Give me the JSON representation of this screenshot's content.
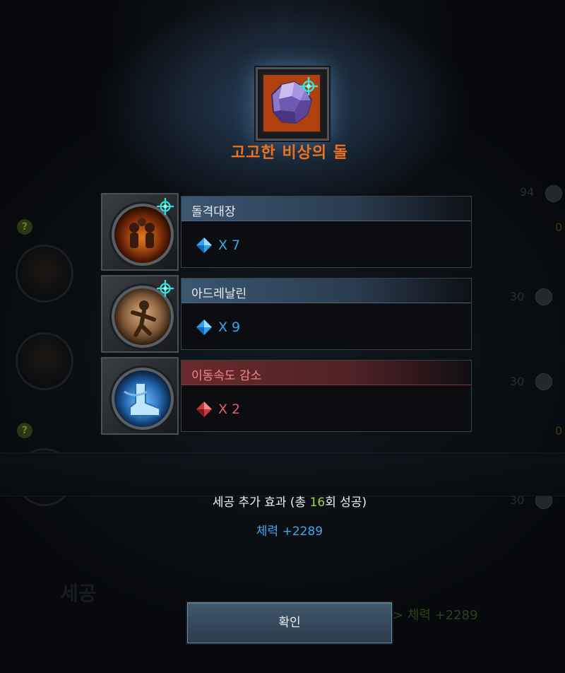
{
  "item": {
    "name": "고고한 비상의 돌",
    "icon": "crystal-stone-icon",
    "frame_color": "#b0410f"
  },
  "skills": [
    {
      "name": "돌격대장",
      "count_prefix": "X",
      "count": "7",
      "type": "positive",
      "gem": "blue-gem-icon",
      "icon": "charge-captain-icon"
    },
    {
      "name": "아드레날린",
      "count_prefix": "X",
      "count": "9",
      "type": "positive",
      "gem": "blue-gem-icon",
      "icon": "adrenaline-icon"
    },
    {
      "name": "이동속도 감소",
      "count_prefix": "X",
      "count": "2",
      "type": "negative",
      "gem": "red-gem-icon",
      "icon": "slow-boot-icon"
    }
  ],
  "bonus": {
    "title_prefix": "세공 추가 효과 (총 ",
    "success_count": "16",
    "title_suffix": "회 성공)",
    "value": "체력 +2289"
  },
  "confirm_label": "확인",
  "background": {
    "numbers": [
      "94",
      "0",
      "0",
      "30",
      "30",
      "30"
    ],
    "help_labels": [
      "?",
      "?"
    ],
    "ghost_title": "세공",
    "ghost_bonus": "> 체력 +2289"
  },
  "colors": {
    "title": "#f0711c",
    "positive": "#35a8e8",
    "negative": "#e06060",
    "success_highlight": "#9ed83b"
  }
}
